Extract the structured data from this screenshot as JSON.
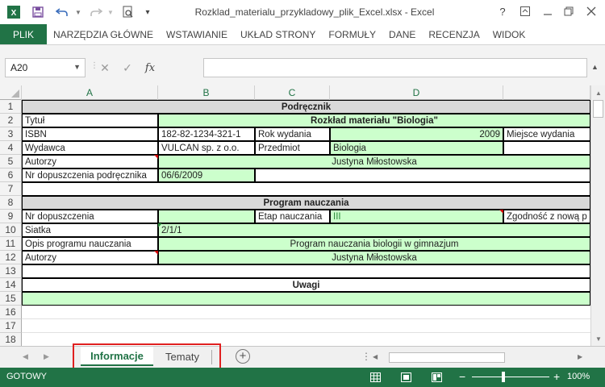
{
  "window": {
    "title": "Rozklad_materialu_przykladowy_plik_Excel.xlsx - Excel",
    "help": "?"
  },
  "ribbon": {
    "file": "PLIK",
    "tabs": [
      "NARZĘDZIA GŁÓWNE",
      "WSTAWIANIE",
      "UKŁAD STRONY",
      "FORMUŁY",
      "DANE",
      "RECENZJA",
      "WIDOK"
    ]
  },
  "formula_bar": {
    "name_box": "A20",
    "fx_label": "fx",
    "cancel": "✕",
    "confirm": "✓",
    "value": ""
  },
  "columns": [
    "A",
    "B",
    "C",
    "D"
  ],
  "rows": [
    "1",
    "2",
    "3",
    "4",
    "5",
    "6",
    "7",
    "8",
    "9",
    "10",
    "11",
    "12",
    "13",
    "14",
    "15",
    "16",
    "17",
    "18"
  ],
  "sheet": {
    "r1": "Podręcznik",
    "r2a": "Tytuł",
    "r2b": "Rozkład materiału \"Biologia\"",
    "r3a": "ISBN",
    "r3b": "182-82-1234-321-1",
    "r3c": "Rok wydania",
    "r3d": "2009",
    "r3e": "Miejsce wydania",
    "r4a": "Wydawca",
    "r4b": "VULCAN sp. z o.o.",
    "r4c": "Przedmiot",
    "r4d": "Biologia",
    "r5a": "Autorzy",
    "r5b": "Justyna Miłostowska",
    "r6a": "Nr dopuszczenia podręcznika",
    "r6b": "06/6/2009",
    "r8": "Program nauczania",
    "r9a": "Nr dopuszczenia",
    "r9c": "Etap nauczania",
    "r9d": "III",
    "r9e": "Zgodność z nową p",
    "r10a": "Siatka",
    "r10b": "2/1/1",
    "r11a": "Opis programu nauczania",
    "r11b": "Program nauczania biologii w gimnazjum",
    "r12a": "Autorzy",
    "r12b": "Justyna Miłostowska",
    "r14": "Uwagi"
  },
  "sheet_tabs": [
    {
      "label": "Informacje",
      "active": true
    },
    {
      "label": "Tematy",
      "active": false
    }
  ],
  "status": {
    "ready": "GOTOWY",
    "zoom": "100%"
  },
  "colors": {
    "excel_green": "#217346",
    "cell_green": "#ccffcc",
    "cell_gray": "#d9d9d9",
    "highlight_red": "#e02020"
  }
}
